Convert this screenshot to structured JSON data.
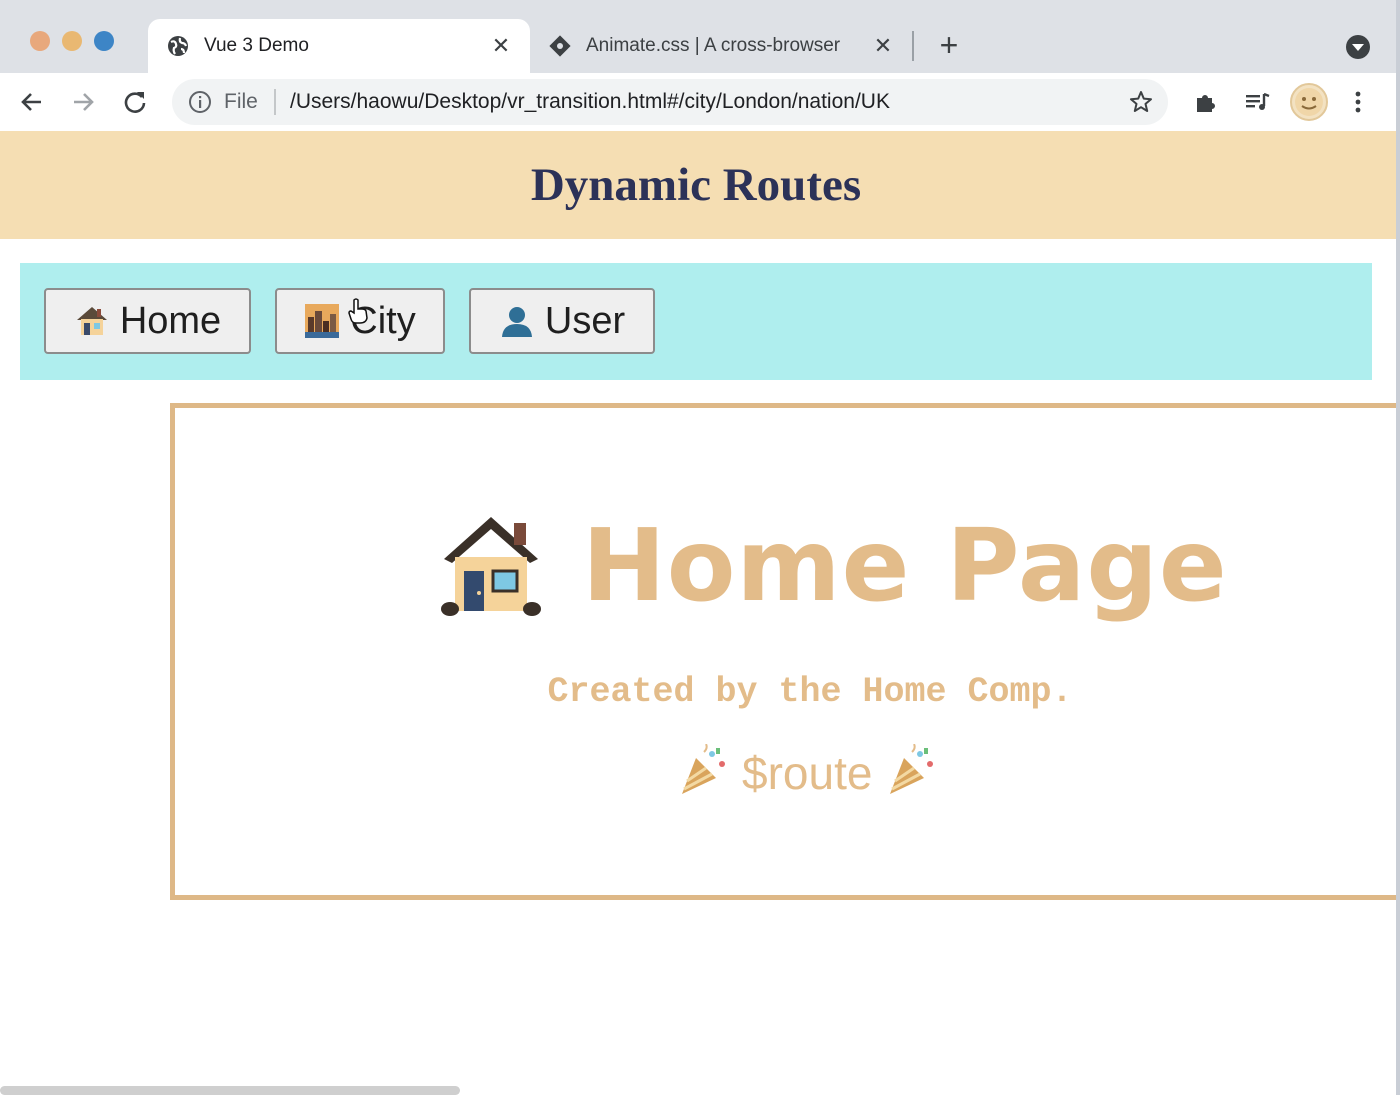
{
  "browser": {
    "tabs": [
      {
        "title": "Vue 3 Demo",
        "favicon": "globe-icon",
        "active": true
      },
      {
        "title": "Animate.css | A cross-browser",
        "favicon": "animate-logo-icon",
        "active": false
      }
    ],
    "address_bar": {
      "scheme_label": "File",
      "url": "/Users/haowu/Desktop/vr_transition.html#/city/London/nation/UK"
    },
    "icons": [
      "back-arrow-icon",
      "forward-arrow-icon",
      "reload-icon",
      "info-icon",
      "star-icon",
      "extensions-puzzle-icon",
      "media-queue-icon",
      "profile-avatar-icon",
      "more-vert-icon",
      "new-tab-plus-icon",
      "tab-close-icon",
      "tab-search-icon"
    ],
    "colors": {
      "tabstrip": "#dee1e6",
      "omnibox": "#f1f3f4"
    }
  },
  "page": {
    "header": {
      "title": "Dynamic Routes",
      "background": "#f5deb3",
      "color": "#2c3258"
    },
    "nav": {
      "background": "#afeeee",
      "buttons": [
        {
          "label": "Home",
          "icon": "house-emoji-icon"
        },
        {
          "label": "City",
          "icon": "cityscape-emoji-icon"
        },
        {
          "label": "User",
          "icon": "user-silhouette-emoji-icon"
        }
      ]
    },
    "content": {
      "border_color": "#deb887",
      "text_color": "#e3bc8a",
      "title": "Home Page",
      "title_icon": "house-emoji-icon",
      "subtitle": "Created by the Home Comp.",
      "route_text": "$route",
      "route_icons": [
        "party-popper-icon",
        "party-popper-icon"
      ]
    }
  }
}
